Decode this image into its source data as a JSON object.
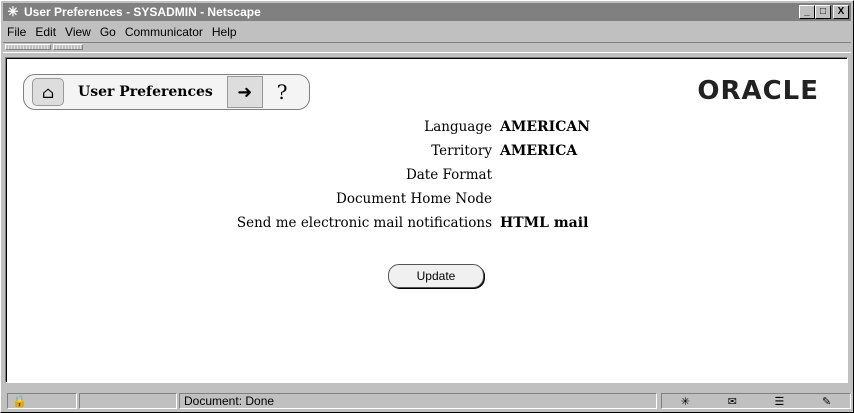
{
  "window": {
    "title": "User Preferences - SYSADMIN - Netscape",
    "app_icon": "netscape-icon",
    "controls": [
      "_",
      "□",
      "X"
    ]
  },
  "menu": {
    "file": "File",
    "edit": "Edit",
    "view": "View",
    "go": "Go",
    "communicator": "Communicator",
    "help": "Help"
  },
  "header": {
    "tab_label": "User Preferences",
    "help_glyph": "?",
    "logo": "ORACLE"
  },
  "preferences": {
    "language_label": "Language",
    "language_value": "AMERICAN",
    "territory_label": "Territory",
    "territory_value": "AMERICA",
    "date_format_label": "Date Format",
    "date_format_value": "",
    "home_node_label": "Document Home Node",
    "home_node_value": "",
    "mail_label": "Send me electronic mail notifications",
    "mail_value": "HTML mail"
  },
  "actions": {
    "update_label": "Update"
  },
  "status": {
    "message": "Document: Done"
  }
}
